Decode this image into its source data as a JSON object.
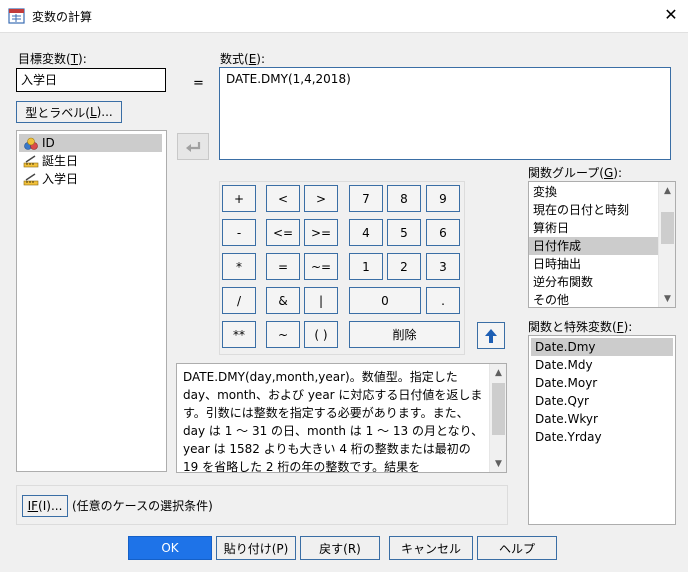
{
  "window": {
    "title": "変数の計算",
    "close": "✕"
  },
  "target": {
    "label_pre": "目標変数(",
    "label_key": "T",
    "label_post": "):",
    "value": "入学日"
  },
  "type_label_button": {
    "pre": "型とラベル(",
    "key": "L",
    "post": ")..."
  },
  "equals": "=",
  "expression": {
    "label_pre": "数式(",
    "label_key": "E",
    "label_post": "):",
    "value": "DATE.DMY(1,4,2018)"
  },
  "variables": [
    {
      "name": "ID",
      "icon": "nominal-icon",
      "selected": true
    },
    {
      "name": "誕生日",
      "icon": "scale-icon",
      "selected": false
    },
    {
      "name": "入学日",
      "icon": "scale-icon",
      "selected": false
    }
  ],
  "keypad": {
    "r1": [
      "+",
      "<",
      ">",
      "7",
      "8",
      "9"
    ],
    "r2": [
      "-",
      "<=",
      ">=",
      "4",
      "5",
      "6"
    ],
    "r3": [
      "*",
      "=",
      "~=",
      "1",
      "2",
      "3"
    ],
    "r4": [
      "/",
      "&",
      "|",
      "0",
      "."
    ],
    "r5": [
      "**",
      "~",
      "( )",
      "削除"
    ]
  },
  "description": "DATE.DMY(day,month,year)。数値型。指定した day、month、および year に対応する日付値を返します。引数には整数を指定する必要があります。また、day は 1 ～ 31 の日、month は 1 ～ 13 の月となり、year は 1582 よりも大きい 4 桁の整数または最初の 19 を省略した 2 桁の年の整数です。結果を",
  "function_group": {
    "label_pre": "関数グループ(",
    "label_key": "G",
    "label_post": "):",
    "items": [
      "変換",
      "現在の日付と時刻",
      "算術日",
      "日付作成",
      "日時抽出",
      "逆分布関数",
      "その他"
    ],
    "selected": 3
  },
  "functions": {
    "label_pre": "関数と特殊変数(",
    "label_key": "F",
    "label_post": "):",
    "items": [
      "Date.Dmy",
      "Date.Mdy",
      "Date.Moyr",
      "Date.Qyr",
      "Date.Wkyr",
      "Date.Yrday"
    ],
    "selected": 0
  },
  "if_button": {
    "pre": "",
    "key": "IF",
    "post": "(I)..."
  },
  "if_text": "(任意のケースの選択条件)",
  "buttons": {
    "ok": "OK",
    "paste": "貼り付け(P)",
    "reset": "戻す(R)",
    "cancel": "キャンセル",
    "help": "ヘルプ"
  },
  "colors": {
    "accent": "#1e73e8",
    "selection": "#cccccc",
    "face": "#f0f0f0"
  }
}
